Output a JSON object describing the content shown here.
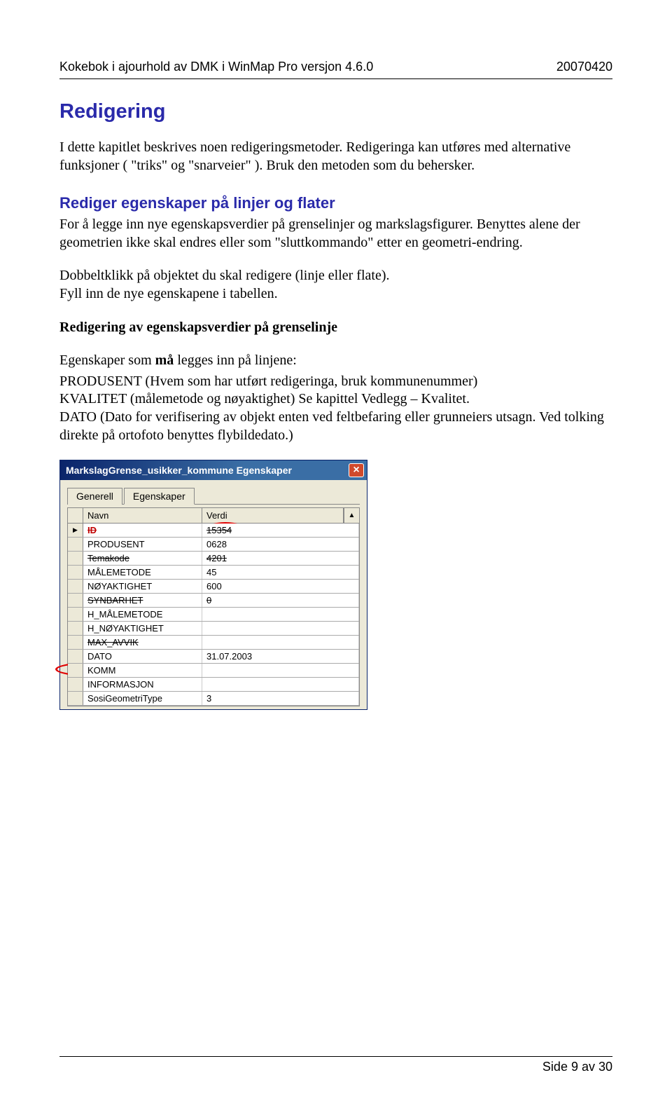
{
  "header": {
    "left": "Kokebok i ajourhold av DMK i WinMap Pro versjon 4.6.0",
    "right": "20070420"
  },
  "title": "Redigering",
  "para1": "I dette kapitlet beskrives noen redigeringsmetoder. Redigeringa kan utføres med alternative funksjoner ( \"triks\" og \"snarveier\" ). Bruk den metoden som du behersker.",
  "sub1": "Rediger egenskaper på linjer og flater",
  "para2": "For å legge inn nye egenskapsverdier på grenselinjer og markslagsfigurer. Benyttes alene der geometrien ikke skal endres eller som \"sluttkommando\" etter en geometri-endring.",
  "para3": "Dobbeltklikk på objektet du skal redigere (linje eller flate).\nFyll inn de nye egenskapene i tabellen.",
  "sub2": "Redigering av egenskapsverdier på grenselinje",
  "para4_lead": "Egenskaper som ",
  "para4_bold": "må",
  "para4_tail": " legges inn på linjene:",
  "para5": "PRODUSENT (Hvem som har utført redigeringa, bruk kommunenummer)\nKVALITET (målemetode og nøyaktighet) Se kapittel Vedlegg – Kvalitet.\nDATO (Dato for verifisering av objekt enten ved feltbefaring eller grunneiers utsagn. Ved tolking direkte på ortofoto benyttes flybildedato.)",
  "dialog": {
    "title": "MarkslagGrense_usikker_kommune Egenskaper",
    "tabs": {
      "generell": "Generell",
      "egenskaper": "Egenskaper"
    },
    "cols": {
      "name": "Navn",
      "value": "Verdi"
    },
    "rows": [
      {
        "name": "ID",
        "value": "15354",
        "red": true,
        "strike_id": true
      },
      {
        "name": "PRODUSENT",
        "value": "0628"
      },
      {
        "name": "Temakode",
        "value": "4201",
        "strike": true
      },
      {
        "name": "MÅLEMETODE",
        "value": "45"
      },
      {
        "name": "NØYAKTIGHET",
        "value": "600"
      },
      {
        "name": "SYNBARHET",
        "value": "0",
        "strike": true
      },
      {
        "name": "H_MÅLEMETODE",
        "value": ""
      },
      {
        "name": "H_NØYAKTIGHET",
        "value": ""
      },
      {
        "name": "MAX_AVVIK",
        "value": "",
        "strike": true
      },
      {
        "name": "DATO",
        "value": "31.07.2003"
      },
      {
        "name": "KOMM",
        "value": ""
      },
      {
        "name": "INFORMASJON",
        "value": ""
      },
      {
        "name": "SosiGeometriType",
        "value": "3"
      }
    ]
  },
  "footer": {
    "right": "Side 9 av 30"
  }
}
